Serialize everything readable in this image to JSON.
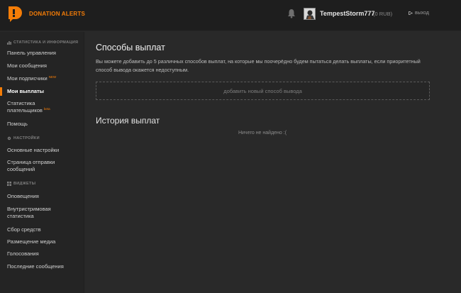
{
  "brand": "DONATION ALERTS",
  "colors": {
    "accent": "#f57d07",
    "background": "#292929",
    "sidebar": "#242424",
    "topbar": "#1e1e1e"
  },
  "user": {
    "name": "TempestStorm777",
    "balance": "(0 RUB)",
    "logout": "выход"
  },
  "sidebar": {
    "sections": [
      {
        "title": "СТАТИСТИКА И ИНФОРМАЦИЯ",
        "icon": "chart-icon"
      },
      {
        "title": "НАСТРОЙКИ",
        "icon": "gear-icon"
      },
      {
        "title": "ВИДЖЕТЫ",
        "icon": "widgets-icon"
      }
    ],
    "items": [
      {
        "label": "Панель управления"
      },
      {
        "label": "Мои сообщения"
      },
      {
        "label": "Мои подписчики",
        "badge": "NEW"
      },
      {
        "label": "Мои выплаты",
        "active": true
      },
      {
        "label": "Статистика",
        "label2": "плательщиков",
        "badge": "beta"
      },
      {
        "label": "Помощь"
      },
      {
        "label": "Основные настройки"
      },
      {
        "label": "Страница отправки",
        "label2": "сообщений"
      },
      {
        "label": "Оповещения"
      },
      {
        "label": "Внутристримовая",
        "label2": "статистика"
      },
      {
        "label": "Сбор средств"
      },
      {
        "label": "Размещение медиа"
      },
      {
        "label": "Голосования"
      },
      {
        "label": "Последние сообщения"
      }
    ]
  },
  "main": {
    "title": "Способы выплат",
    "description": "Вы можете добавить до 5 различных способов выплат, на которые мы поочерёдно будем пытаться делать выплаты, если приоритетный способ вывода окажется недоступным.",
    "add_button": "добавить новый способ вывода",
    "history_title": "История выплат",
    "empty_text": "Ничего не найдено :("
  }
}
